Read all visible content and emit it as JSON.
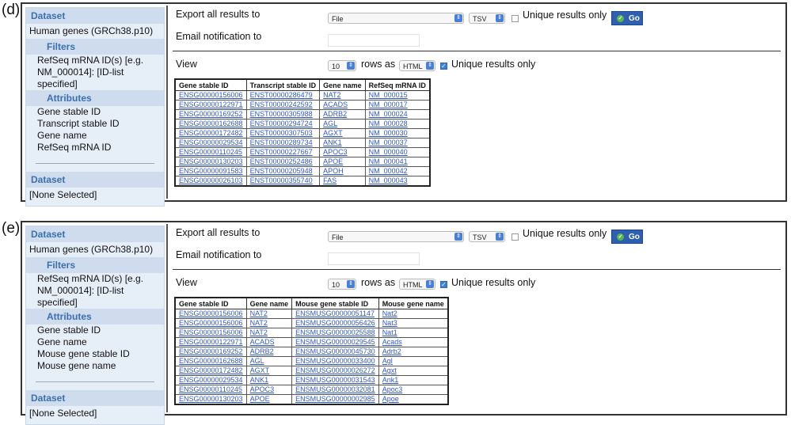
{
  "panels": [
    {
      "letter": "(d)",
      "sidebar": {
        "dataset_head": "Dataset",
        "dataset_value": "Human genes (GRCh38.p10)",
        "filters_head": "Filters",
        "filter_line1": "RefSeq mRNA ID(s) [e.g.",
        "filter_line2": "NM_000014]: [ID-list specified]",
        "attributes_head": "Attributes",
        "attributes": [
          "Gene stable ID",
          "Transcript stable ID",
          "Gene name",
          "RefSeq mRNA ID"
        ],
        "dataset2_head": "Dataset",
        "dataset2_value": "[None Selected]"
      },
      "export": {
        "label": "Export  all results to",
        "dest": "File",
        "format": "TSV",
        "unique_label": "Unique results only",
        "go_label": "Go",
        "email_label": "Email notification to"
      },
      "view": {
        "label": "View",
        "rows": "10",
        "rows_as_label": "rows as",
        "format": "HTML",
        "unique_label": "Unique results only"
      },
      "table": {
        "headers": [
          "Gene stable ID",
          "Transcript stable ID",
          "Gene name",
          "RefSeq mRNA ID"
        ],
        "rows": [
          [
            "ENSG00000156006",
            "ENST00000286479",
            "NAT2",
            "NM_000015"
          ],
          [
            "ENSG00000122971",
            "ENST00000242592",
            "ACADS",
            "NM_000017"
          ],
          [
            "ENSG00000169252",
            "ENST00000305988",
            "ADRB2",
            "NM_000024"
          ],
          [
            "ENSG00000162688",
            "ENST00000294724",
            "AGL",
            "NM_000028"
          ],
          [
            "ENSG00000172482",
            "ENST00000307503",
            "AGXT",
            "NM_000030"
          ],
          [
            "ENSG00000029534",
            "ENST00000289734",
            "ANK1",
            "NM_000037"
          ],
          [
            "ENSG00000110245",
            "ENST00000227667",
            "APOC3",
            "NM_000040"
          ],
          [
            "ENSG00000130203",
            "ENST00000252486",
            "APOE",
            "NM_000041"
          ],
          [
            "ENSG00000091583",
            "ENST00000205948",
            "APOH",
            "NM_000042"
          ],
          [
            "ENSG00000026103",
            "ENST00000355740",
            "FAS",
            "NM_000043"
          ]
        ]
      }
    },
    {
      "letter": "(e)",
      "sidebar": {
        "dataset_head": "Dataset",
        "dataset_value": "Human genes (GRCh38.p10)",
        "filters_head": "Filters",
        "filter_line1": "RefSeq mRNA ID(s) [e.g.",
        "filter_line2": "NM_000014]: [ID-list specified]",
        "attributes_head": "Attributes",
        "attributes": [
          "Gene stable ID",
          "Gene name",
          "Mouse gene stable ID",
          "Mouse gene name"
        ],
        "dataset2_head": "Dataset",
        "dataset2_value": "[None Selected]"
      },
      "export": {
        "label": "Export  all results to",
        "dest": "File",
        "format": "TSV",
        "unique_label": "Unique results only",
        "go_label": "Go",
        "email_label": "Email notification to"
      },
      "view": {
        "label": "View",
        "rows": "10",
        "rows_as_label": "rows as",
        "format": "HTML",
        "unique_label": "Unique results only"
      },
      "table": {
        "headers": [
          "Gene stable ID",
          "Gene name",
          "Mouse gene stable ID",
          "Mouse gene name"
        ],
        "rows": [
          [
            "ENSG00000156006",
            "NAT2",
            "ENSMUSG00000051147",
            "Nat2"
          ],
          [
            "ENSG00000156006",
            "NAT2",
            "ENSMUSG00000056426",
            "Nat3"
          ],
          [
            "ENSG00000156006",
            "NAT2",
            "ENSMUSG00000025588",
            "Nat1"
          ],
          [
            "ENSG00000122971",
            "ACADS",
            "ENSMUSG00000029545",
            "Acads"
          ],
          [
            "ENSG00000169252",
            "ADRB2",
            "ENSMUSG00000045730",
            "Adrb2"
          ],
          [
            "ENSG00000162688",
            "AGL",
            "ENSMUSG00000033400",
            "Agl"
          ],
          [
            "ENSG00000172482",
            "AGXT",
            "ENSMUSG00000026272",
            "Agxt"
          ],
          [
            "ENSG00000029534",
            "ANK1",
            "ENSMUSG00000031543",
            "Ank1"
          ],
          [
            "ENSG00000110245",
            "APOC3",
            "ENSMUSG00000032081",
            "Apoc3"
          ],
          [
            "ENSG00000130203",
            "APOE",
            "ENSMUSG00000002985",
            "Apoe"
          ]
        ]
      }
    }
  ]
}
